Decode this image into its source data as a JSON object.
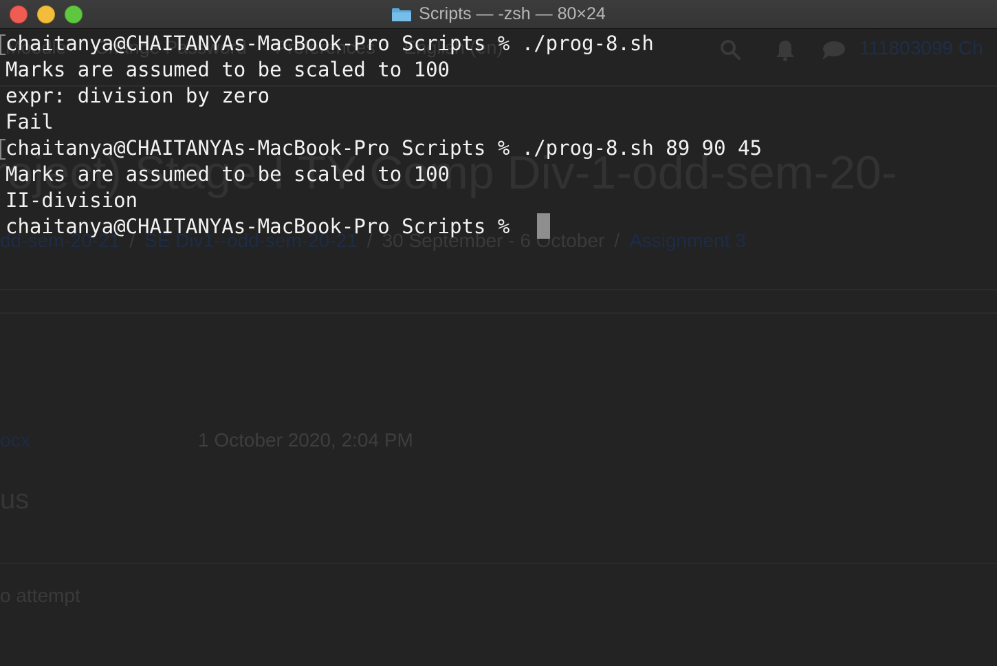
{
  "window": {
    "title": "Scripts — -zsh — 80×24",
    "folder_icon": "folder-icon"
  },
  "background_page": {
    "nav": [
      "Moodle",
      "Change Password",
      "Preferences",
      "English (en)"
    ],
    "user": "111803099 Ch",
    "heading": "roject) Stage-I TY Comp Div-1-odd-sem-20-",
    "breadcrumb": [
      {
        "label": "dd-sem-20-21",
        "link": true
      },
      {
        "label": "SE Div1--odd-sem-20-21",
        "link": true
      },
      {
        "label": "30 September - 6 October",
        "link": false
      },
      {
        "label": "Assignment 3",
        "link": true
      }
    ],
    "file_name": "ocx",
    "file_date": "1 October 2020, 2:04 PM",
    "status_heading": "us",
    "attempt_text": "o attempt"
  },
  "terminal": {
    "lines": [
      "chaitanya@CHAITANYAs-MacBook-Pro Scripts % ./prog-8.sh",
      "Marks are assumed to be scaled to 100",
      "expr: division by zero",
      "Fail",
      "chaitanya@CHAITANYAs-MacBook-Pro Scripts % ./prog-8.sh 89 90 45",
      "Marks are assumed to be scaled to 100",
      "II-division",
      "chaitanya@CHAITANYAs-MacBook-Pro Scripts % "
    ]
  },
  "colors": {
    "terminal_bg": "#232323",
    "text": "#f2f2f2",
    "close": "#ee5c54",
    "minimize": "#f2bd3a",
    "zoom": "#5fc73f"
  }
}
